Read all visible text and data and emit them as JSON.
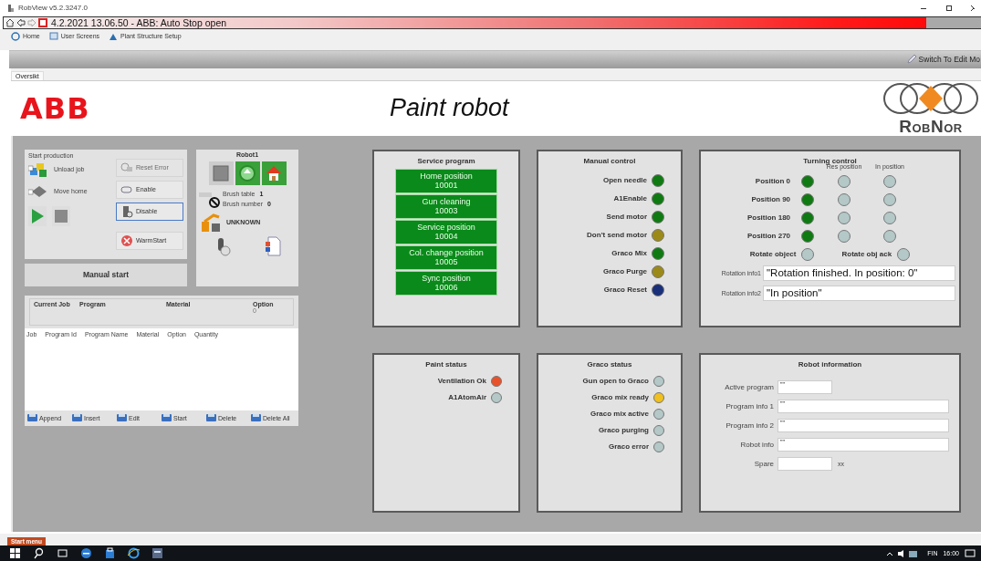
{
  "app_title": "RobView v5.2.3247.0",
  "alarm": {
    "text": "4.2.2021 13.06.50 - ABB: Auto Stop open"
  },
  "menu": [
    {
      "label": "Home"
    },
    {
      "label": "User Screens"
    },
    {
      "label": "Plant Structure Setup"
    }
  ],
  "edit_mode_button": "Switch To Edit Mo",
  "tabs": [
    {
      "label": "Oversikt",
      "selected": true
    }
  ],
  "header": {
    "logo": "ABB",
    "title": "Paint robot",
    "brand": "RobNor"
  },
  "start_production": {
    "title": "Start production",
    "actions": [
      "Unload job",
      "Move home"
    ],
    "buttons": [
      {
        "label": "Reset Error",
        "disabled": true,
        "selected": false
      },
      {
        "label": "Enable",
        "disabled": false,
        "selected": false
      },
      {
        "label": "Disable",
        "disabled": false,
        "selected": true
      },
      {
        "label": "WarmStart",
        "disabled": false,
        "selected": false
      }
    ]
  },
  "manual_start": "Manual start",
  "robot": {
    "title": "Robot1",
    "brush_table_label": "Brush table",
    "brush_table_value": "1",
    "brush_number_label": "Brush number",
    "brush_number_value": "0",
    "state": "UNKNOWN"
  },
  "job": {
    "header": [
      "Current Job",
      "Program",
      "Material",
      "Option"
    ],
    "option_value": "0",
    "columns": [
      "Job",
      "Program Id",
      "Program Name",
      "Material",
      "Option",
      "Quantity"
    ],
    "buttons": [
      "Append",
      "Insert",
      "Edit",
      "Start",
      "Delete",
      "Delete All"
    ]
  },
  "service_program": {
    "title": "Service program",
    "items": [
      {
        "name": "Home position",
        "number": "10001"
      },
      {
        "name": "Gun cleaning",
        "number": "10003"
      },
      {
        "name": "Service position",
        "number": "10004"
      },
      {
        "name": "Col. change position",
        "number": "10005"
      },
      {
        "name": "Sync position",
        "number": "10006"
      }
    ]
  },
  "manual_control": {
    "title": "Manual control",
    "signals": [
      {
        "label": "Open needle",
        "color": "#0f7a12"
      },
      {
        "label": "A1Enable",
        "color": "#0f7a12"
      },
      {
        "label": "Send motor",
        "color": "#0f7a12"
      },
      {
        "label": "Don't send motor",
        "color": "#9c8a18"
      },
      {
        "label": "Graco Mix",
        "color": "#0f7a12"
      },
      {
        "label": "Graco Purge",
        "color": "#9c8a18"
      },
      {
        "label": "Graco Reset",
        "color": "#1a2f7a"
      }
    ]
  },
  "turning_control": {
    "title": "Turning control",
    "column_headers": [
      "Res position",
      "In position"
    ],
    "positions": [
      {
        "label": "Position 0",
        "lamps": [
          {
            "color": "#0f7a12"
          },
          {
            "color": "#b4c8c8"
          },
          {
            "color": "#b4c8c8"
          }
        ]
      },
      {
        "label": "Position 90",
        "lamps": [
          {
            "color": "#0f7a12"
          },
          {
            "color": "#b4c8c8"
          },
          {
            "color": "#b4c8c8"
          }
        ]
      },
      {
        "label": "Position 180",
        "lamps": [
          {
            "color": "#0f7a12"
          },
          {
            "color": "#b4c8c8"
          },
          {
            "color": "#b4c8c8"
          }
        ]
      },
      {
        "label": "Position 270",
        "lamps": [
          {
            "color": "#0f7a12"
          },
          {
            "color": "#b4c8c8"
          },
          {
            "color": "#b4c8c8"
          }
        ]
      }
    ],
    "rotate": [
      {
        "label": "Rotate object",
        "color": "#b4c8c8"
      },
      {
        "label": "Rotate obj ack",
        "color": "#b4c8c8"
      }
    ],
    "info": [
      {
        "label": "Rotation info1",
        "value": "\"Rotation finished. In position: 0\""
      },
      {
        "label": "Rotation info2",
        "value": "\"In position\""
      }
    ]
  },
  "paint_status": {
    "title": "Paint status",
    "signals": [
      {
        "label": "Ventilation Ok",
        "color": "#e8522a"
      },
      {
        "label": "A1AtomAir",
        "color": "#b4c8c8"
      }
    ]
  },
  "graco_status": {
    "title": "Graco status",
    "signals": [
      {
        "label": "Gun open to Graco",
        "color": "#b4c8c8"
      },
      {
        "label": "Graco mix ready",
        "color": "#f0c020"
      },
      {
        "label": "Graco mix active",
        "color": "#b4c8c8"
      },
      {
        "label": "Graco purging",
        "color": "#b4c8c8"
      },
      {
        "label": "Graco error",
        "color": "#b4c8c8"
      }
    ]
  },
  "robot_information": {
    "title": "Robot information",
    "fields": [
      {
        "label": "Active program",
        "value": "\"\"",
        "kind": "short"
      },
      {
        "label": "Program info 1",
        "value": "\"\"",
        "kind": "long"
      },
      {
        "label": "Program info 2",
        "value": "\"\"",
        "kind": "long"
      },
      {
        "label": "Robot info",
        "value": "\"\"",
        "kind": "long"
      },
      {
        "label": "Spare",
        "kind": "short",
        "suffix": "xx"
      }
    ]
  },
  "start_menu": "Start menu",
  "taskbar": {
    "language": "FIN",
    "clock": "16:00"
  }
}
